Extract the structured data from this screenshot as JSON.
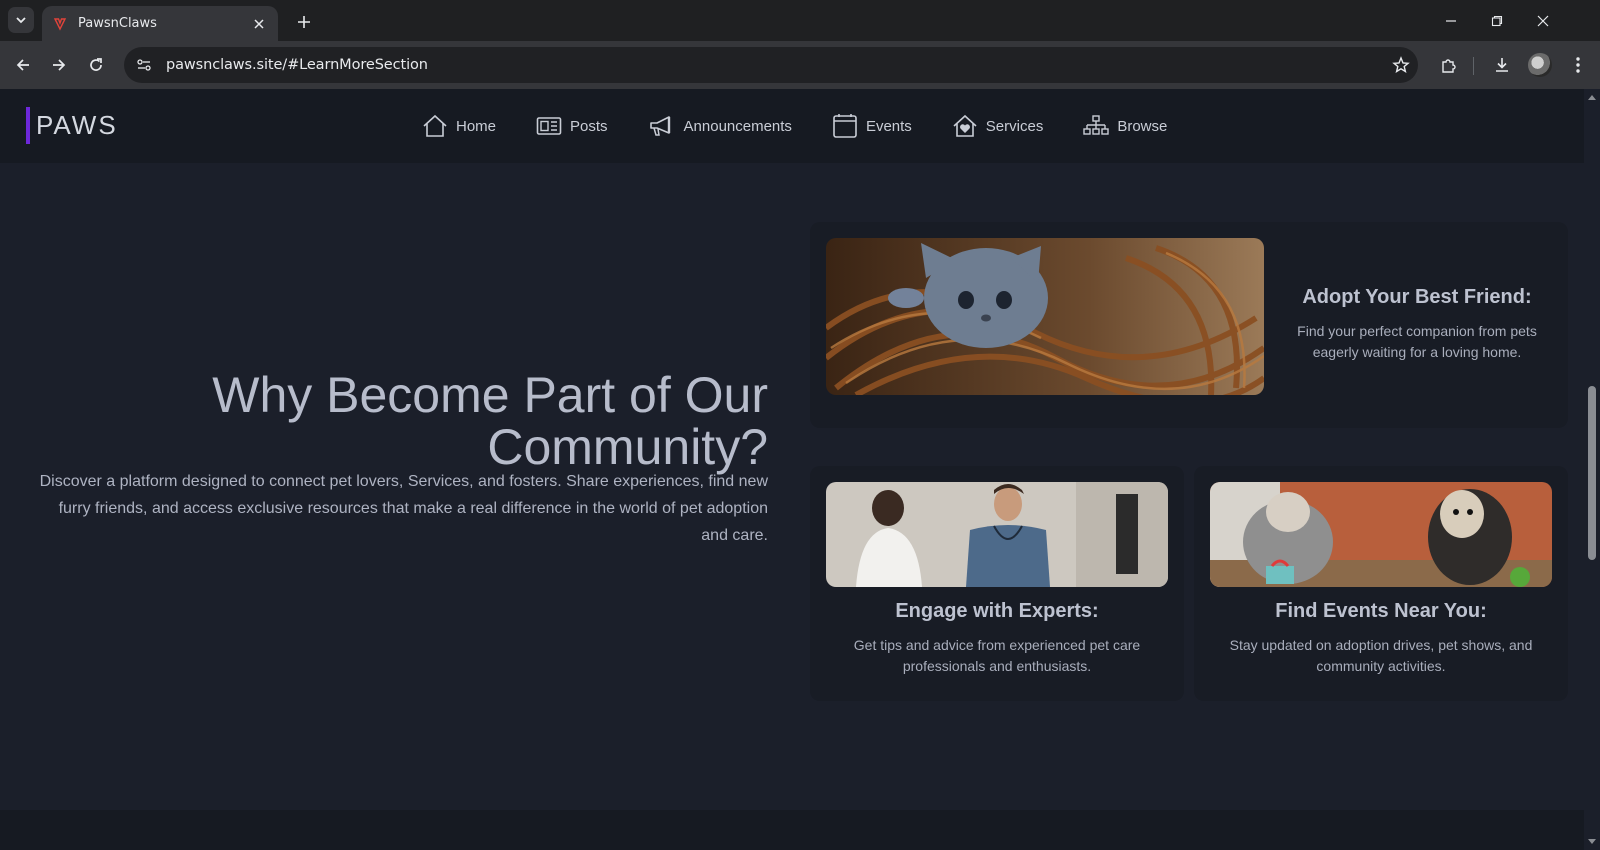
{
  "browser": {
    "tab_title": "PawsnClaws",
    "url": "pawsnclaws.site/#LearnMoreSection"
  },
  "site": {
    "logo": "PAWS",
    "nav": [
      {
        "label": "Home",
        "icon": "home-icon"
      },
      {
        "label": "Posts",
        "icon": "newspaper-icon"
      },
      {
        "label": "Announcements",
        "icon": "megaphone-icon"
      },
      {
        "label": "Events",
        "icon": "calendar-icon"
      },
      {
        "label": "Services",
        "icon": "house-heart-icon"
      },
      {
        "label": "Browse",
        "icon": "sitemap-icon"
      }
    ]
  },
  "hero": {
    "title": "Why Become Part of Our Community?",
    "description": "Discover a platform designed to connect pet lovers, Services, and fosters. Share experiences, find new furry friends, and access exclusive resources that make a real difference in the world of pet adoption and care."
  },
  "cards": {
    "adopt": {
      "title": "Adopt Your Best Friend:",
      "text": "Find your perfect companion from pets eagerly waiting for a loving home."
    },
    "experts": {
      "title": "Engage with Experts:",
      "text": "Get tips and advice from experienced pet care professionals and enthusiasts."
    },
    "events": {
      "title": "Find Events Near You:",
      "text": "Stay updated on adoption drives, pet shows, and community activities."
    }
  },
  "colors": {
    "accent": "#6d28d9",
    "page_bg": "#1b1f2a",
    "header_bg": "#161a22",
    "card_bg": "#181c25"
  }
}
